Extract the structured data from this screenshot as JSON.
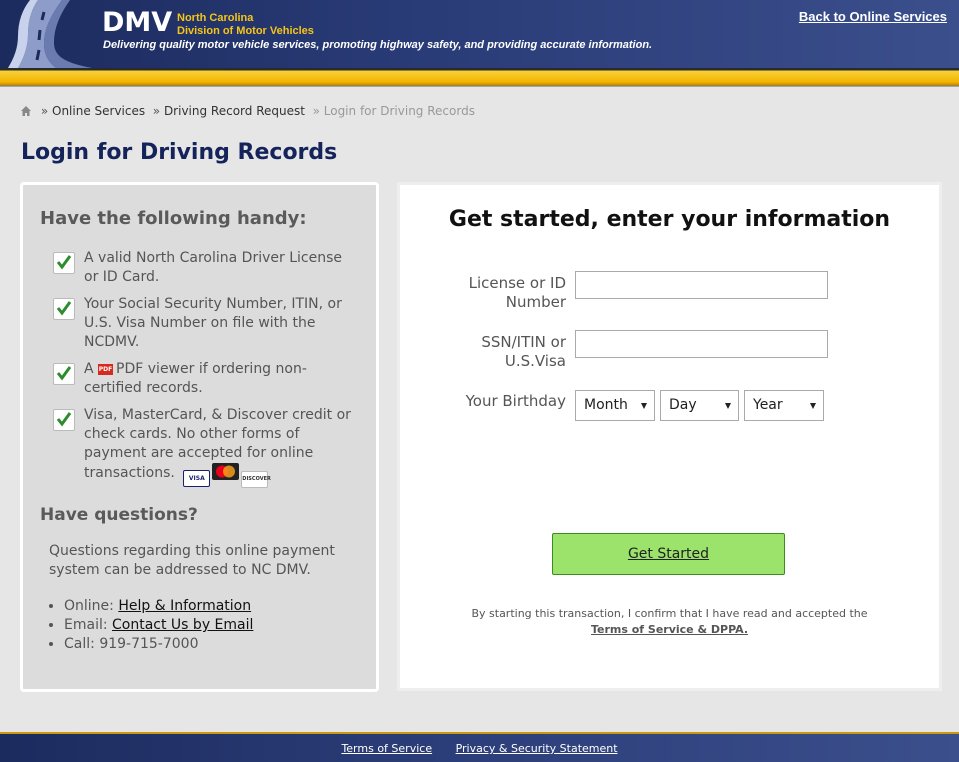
{
  "header": {
    "brand": "DMV",
    "brand_line1": "North Carolina",
    "brand_line2": "Division of Motor Vehicles",
    "tagline": "Delivering quality motor vehicle services, promoting highway safety, and providing accurate information.",
    "back_link": "Back to Online Services"
  },
  "breadcrumb": {
    "items": [
      "Online Services",
      "Driving Record Request"
    ],
    "current": "Login for Driving Records",
    "separator": "»"
  },
  "page_title": "Login for Driving Records",
  "left_panel": {
    "heading": "Have the following handy:",
    "items": [
      "A valid North Carolina Driver License or ID Card.",
      "Your Social Security Number, ITIN, or U.S. Visa Number on file with the NCDMV.",
      "viewer if ordering non-certified records.",
      "Visa, MasterCard, & Discover credit or check cards. No other forms of payment are accepted for online transactions."
    ],
    "item3_prefix": "A",
    "item3_pdf_label": "PDF",
    "pdf_icon_text": "PDF",
    "card_labels": {
      "visa": "VISA",
      "discover": "DISCOVER"
    },
    "questions_heading": "Have questions?",
    "questions_text": "Questions regarding this online payment system can be addressed to NC DMV.",
    "contacts": [
      {
        "label": "Online:",
        "link": "Help & Information"
      },
      {
        "label": "Email:",
        "link": "Contact Us by Email"
      },
      {
        "label": "Call:",
        "value": "919-715-7000"
      }
    ]
  },
  "form": {
    "heading": "Get started, enter your information",
    "license_label": "License or ID Number",
    "license_value": "",
    "ssn_label": "SSN/ITIN or U.S.Visa",
    "ssn_value": "",
    "birthday_label": "Your Birthday",
    "month": "Month",
    "day": "Day",
    "year": "Year",
    "submit": "Get Started",
    "consent_text": "By starting this transaction, I confirm that I have read and accepted the",
    "consent_link": "Terms of Service & DPPA."
  },
  "footer": {
    "links": [
      "Terms of Service",
      "Privacy & Security Statement"
    ]
  },
  "colors": {
    "header_navy": "#1c2b5e",
    "gold": "#f4b400",
    "title_navy": "#14235a",
    "button_green": "#9be36a",
    "check_green": "#2e8b2e"
  },
  "icons": [
    "road-logo-icon",
    "home-icon",
    "checkmark-icon",
    "pdf-icon",
    "visa-card-icon",
    "mastercard-icon",
    "discover-card-icon",
    "dropdown-arrow-icon"
  ]
}
